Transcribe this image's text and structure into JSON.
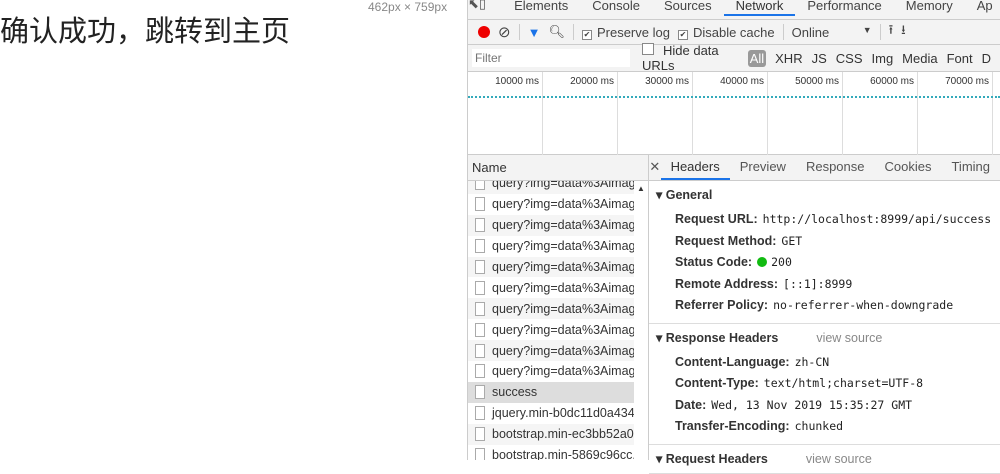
{
  "page": {
    "heading": "确认成功，跳转到主页",
    "dimensions": "462px × 759px"
  },
  "tabs": [
    "Elements",
    "Console",
    "Sources",
    "Network",
    "Performance",
    "Memory",
    "Ap"
  ],
  "toolbar": {
    "preserve_log": "Preserve log",
    "disable_cache": "Disable cache",
    "throttle": "Online"
  },
  "filter": {
    "placeholder": "Filter",
    "hide_data_urls": "Hide data URLs",
    "types": [
      "All",
      "XHR",
      "JS",
      "CSS",
      "Img",
      "Media",
      "Font",
      "D"
    ]
  },
  "timeline": [
    "10000 ms",
    "20000 ms",
    "30000 ms",
    "40000 ms",
    "50000 ms",
    "60000 ms",
    "70000 ms"
  ],
  "list": {
    "header": "Name",
    "rows": [
      "query?img=data%3Aimag.",
      "query?img=data%3Aimag.",
      "query?img=data%3Aimag.",
      "query?img=data%3Aimag.",
      "query?img=data%3Aimag.",
      "query?img=data%3Aimag.",
      "query?img=data%3Aimag.",
      "query?img=data%3Aimag.",
      "query?img=data%3Aimag.",
      "query?img=data%3Aimag.",
      "success",
      "jquery.min-b0dc11d0a434.",
      "bootstrap.min-ec3bb52a0.",
      "bootstrap.min-5869c96cc."
    ]
  },
  "detail": {
    "tabs": [
      "Headers",
      "Preview",
      "Response",
      "Cookies",
      "Timing"
    ],
    "general": {
      "title": "General",
      "items": [
        [
          "Request URL:",
          "http://localhost:8999/api/success"
        ],
        [
          "Request Method:",
          "GET"
        ],
        [
          "Status Code:",
          "200"
        ],
        [
          "Remote Address:",
          "[::1]:8999"
        ],
        [
          "Referrer Policy:",
          "no-referrer-when-downgrade"
        ]
      ]
    },
    "response": {
      "title": "Response Headers",
      "view_source": "view source",
      "items": [
        [
          "Content-Language:",
          "zh-CN"
        ],
        [
          "Content-Type:",
          "text/html;charset=UTF-8"
        ],
        [
          "Date:",
          "Wed, 13 Nov 2019 15:35:27 GMT"
        ],
        [
          "Transfer-Encoding:",
          "chunked"
        ]
      ]
    },
    "request": {
      "title": "Request Headers",
      "view_source": "view source"
    }
  }
}
